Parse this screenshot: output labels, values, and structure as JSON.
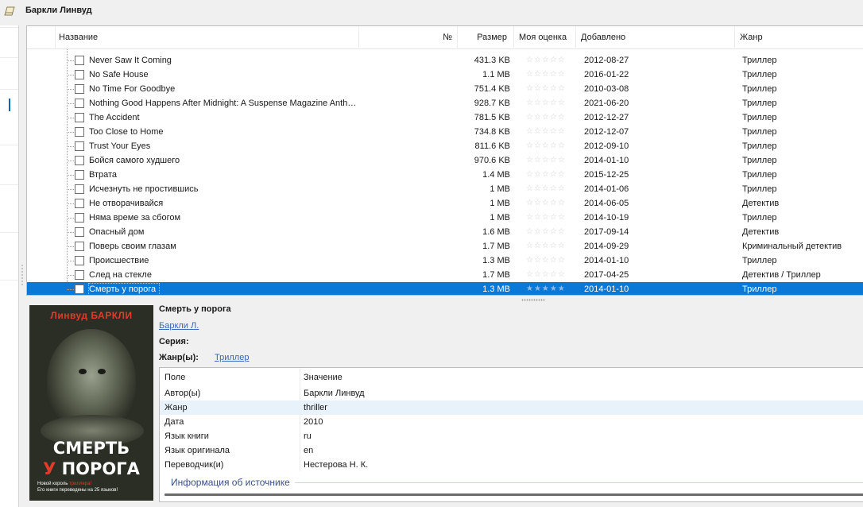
{
  "window": {
    "title": "Баркли Линвуд"
  },
  "table": {
    "columns": {
      "title": "Название",
      "number": "№",
      "size": "Размер",
      "rating": "Моя оценка",
      "added": "Добавлено",
      "genre": "Жанр"
    },
    "rating_empty": "☆☆☆☆☆",
    "rating_selected": "★★★★★",
    "rows": [
      {
        "title": "Never Saw It Coming",
        "size": "431.3 KB",
        "added": "2012-08-27",
        "genre": "Триллер"
      },
      {
        "title": "No Safe House",
        "size": "1.1 MB",
        "added": "2016-01-22",
        "genre": "Триллер"
      },
      {
        "title": "No Time For Goodbye",
        "size": "751.4 KB",
        "added": "2010-03-08",
        "genre": "Триллер"
      },
      {
        "title": "Nothing Good Happens After Midnight: A Suspense Magazine Anth…",
        "size": "928.7 KB",
        "added": "2021-06-20",
        "genre": "Триллер"
      },
      {
        "title": "The Accident",
        "size": "781.5 KB",
        "added": "2012-12-27",
        "genre": "Триллер"
      },
      {
        "title": "Too Close to Home",
        "size": "734.8 KB",
        "added": "2012-12-07",
        "genre": "Триллер"
      },
      {
        "title": "Trust Your Eyes",
        "size": "811.6 KB",
        "added": "2012-09-10",
        "genre": "Триллер"
      },
      {
        "title": "Бойся самого худшего",
        "size": "970.6 KB",
        "added": "2014-01-10",
        "genre": "Триллер"
      },
      {
        "title": "Втрата",
        "size": "1.4 MB",
        "added": "2015-12-25",
        "genre": "Триллер"
      },
      {
        "title": "Исчезнуть не простившись",
        "size": "1 MB",
        "added": "2014-01-06",
        "genre": "Триллер"
      },
      {
        "title": "Не отворачивайся",
        "size": "1 MB",
        "added": "2014-06-05",
        "genre": "Детектив"
      },
      {
        "title": "Няма време за сбогом",
        "size": "1 MB",
        "added": "2014-10-19",
        "genre": "Триллер"
      },
      {
        "title": "Опасный дом",
        "size": "1.6 MB",
        "added": "2017-09-14",
        "genre": "Детектив"
      },
      {
        "title": "Поверь своим глазам",
        "size": "1.7 MB",
        "added": "2014-09-29",
        "genre": "Криминальный детектив"
      },
      {
        "title": "Происшествие",
        "size": "1.3 MB",
        "added": "2014-01-10",
        "genre": "Триллер"
      },
      {
        "title": "След на стекле",
        "size": "1.7 MB",
        "added": "2017-04-25",
        "genre": "Детектив / Триллер"
      },
      {
        "title": "Смерть у порога",
        "size": "1.3 MB",
        "added": "2014-01-10",
        "genre": "Триллер"
      }
    ],
    "selected_index": 16
  },
  "cover": {
    "author": "Линвуд БАРКЛИ",
    "title_line1": "СМЕРТЬ",
    "title_line2_a": "У",
    "title_line2_b": " ПОРОГА",
    "tagline_a": "Новой король ",
    "tagline_b": "триллера!",
    "tagline_c": "Его книги переведены на 25 языков!"
  },
  "details": {
    "title": "Смерть у порога",
    "author": "Баркли Л.",
    "series_label": "Серия:",
    "genre_label": "Жанр(ы):",
    "genre_value": "Триллер"
  },
  "properties": {
    "col_field": "Поле",
    "col_value": "Значение",
    "rows": [
      {
        "key": "Автор(ы)",
        "value": "Баркли Линвуд"
      },
      {
        "key": "Жанр",
        "value": "thriller"
      },
      {
        "key": "Дата",
        "value": "2010"
      },
      {
        "key": "Язык книги",
        "value": "ru"
      },
      {
        "key": "Язык оригинала",
        "value": "en"
      },
      {
        "key": "Переводчик(и)",
        "value": "Нестерова Н. К."
      }
    ],
    "section": "Информация об источнике"
  },
  "colors": {
    "selection": "#0a78d7",
    "link": "#3a67b8",
    "accent_red": "#e23b2a"
  }
}
